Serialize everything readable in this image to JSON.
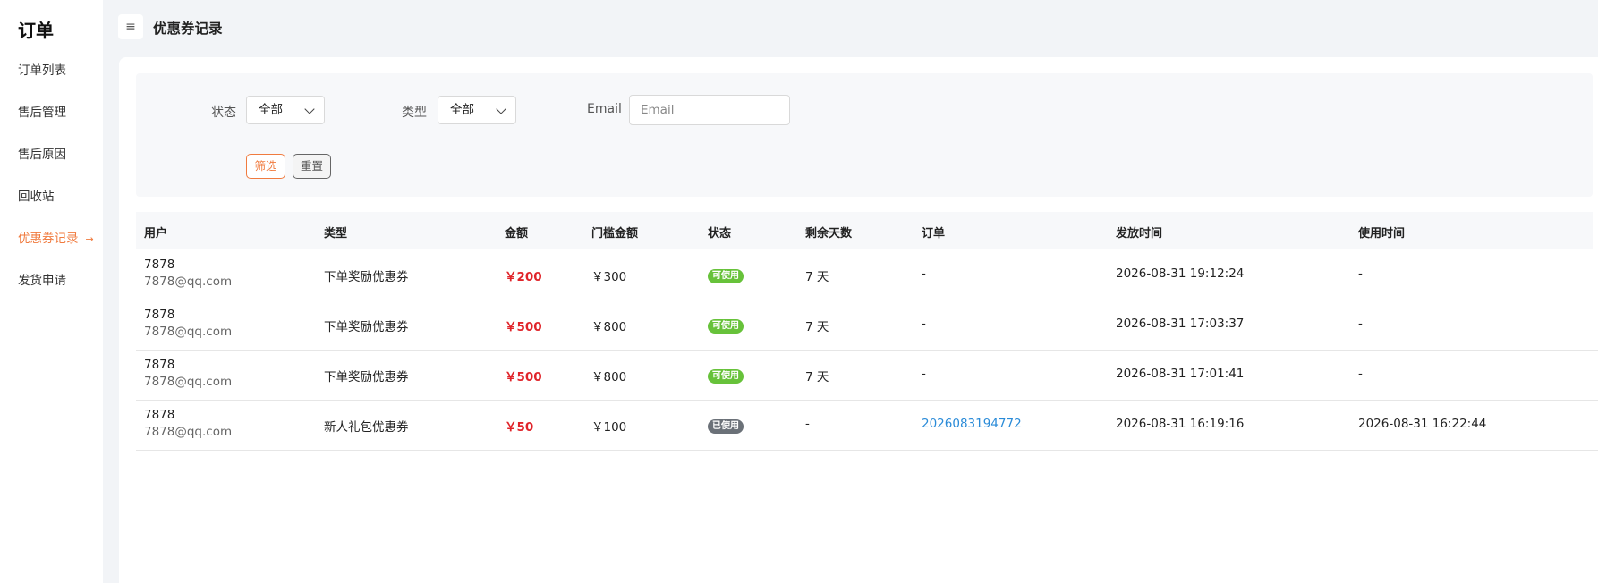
{
  "sidebar": {
    "brand": "订单",
    "items": [
      {
        "label": "订单列表",
        "active": false
      },
      {
        "label": "售后管理",
        "active": false
      },
      {
        "label": "售后原因",
        "active": false
      },
      {
        "label": "回收站",
        "active": false
      },
      {
        "label": "优惠券记录",
        "active": true,
        "arrow": "→"
      },
      {
        "label": "发货申请",
        "active": false
      }
    ]
  },
  "header": {
    "menu_icon": "≡",
    "title": "优惠券记录"
  },
  "filters": {
    "status_label": "状态",
    "status_value": "全部",
    "type_label": "类型",
    "type_value": "全部",
    "email_label": "Email",
    "email_placeholder": "Email",
    "filter_button": "筛选",
    "reset_button": "重置"
  },
  "table": {
    "headers": [
      "用户",
      "类型",
      "金额",
      "门槛金额",
      "状态",
      "剩余天数",
      "订单",
      "发放时间",
      "使用时间"
    ],
    "rows": [
      {
        "user_id": "7878",
        "email": "7878@qq.com",
        "type": "下单奖励优惠券",
        "amount": "￥200",
        "threshold": "￥300",
        "status": "可使用",
        "days_left": "7 天",
        "order": "-",
        "issued_at": "2026-08-31 19:12:24",
        "used_at": "-"
      },
      {
        "user_id": "7878",
        "email": "7878@qq.com",
        "type": "下单奖励优惠券",
        "amount": "￥500",
        "threshold": "￥800",
        "status": "可使用",
        "days_left": "7 天",
        "order": "-",
        "issued_at": "2026-08-31 17:03:37",
        "used_at": "-"
      },
      {
        "user_id": "7878",
        "email": "7878@qq.com",
        "type": "下单奖励优惠券",
        "amount": "￥500",
        "threshold": "￥800",
        "status": "可使用",
        "days_left": "7 天",
        "order": "-",
        "issued_at": "2026-08-31 17:01:41",
        "used_at": "-"
      },
      {
        "user_id": "7878",
        "email": "7878@qq.com",
        "type": "新人礼包优惠券",
        "amount": "￥50",
        "threshold": "￥100",
        "status": "已使用",
        "days_left": "-",
        "order": "2026083194772",
        "issued_at": "2026-08-31 16:19:16",
        "used_at": "2026-08-31 16:22:44"
      }
    ]
  },
  "colors": {
    "accent": "#f07b3f",
    "amount": "#e0242a",
    "badge_available": "#67c23a",
    "badge_used": "#6b7178",
    "link": "#2a8bd8"
  }
}
